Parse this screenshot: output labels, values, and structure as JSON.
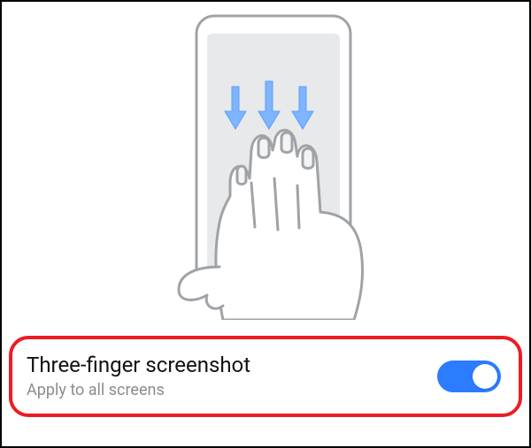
{
  "setting": {
    "title": "Three-finger screenshot",
    "subtitle": "Apply to all screens",
    "enabled": true
  },
  "colors": {
    "toggle_on": "#2b7cff",
    "highlight_border": "#ed1c24"
  },
  "illustration": {
    "description": "Hand swiping down with three fingers on a phone",
    "arrows": 3
  }
}
